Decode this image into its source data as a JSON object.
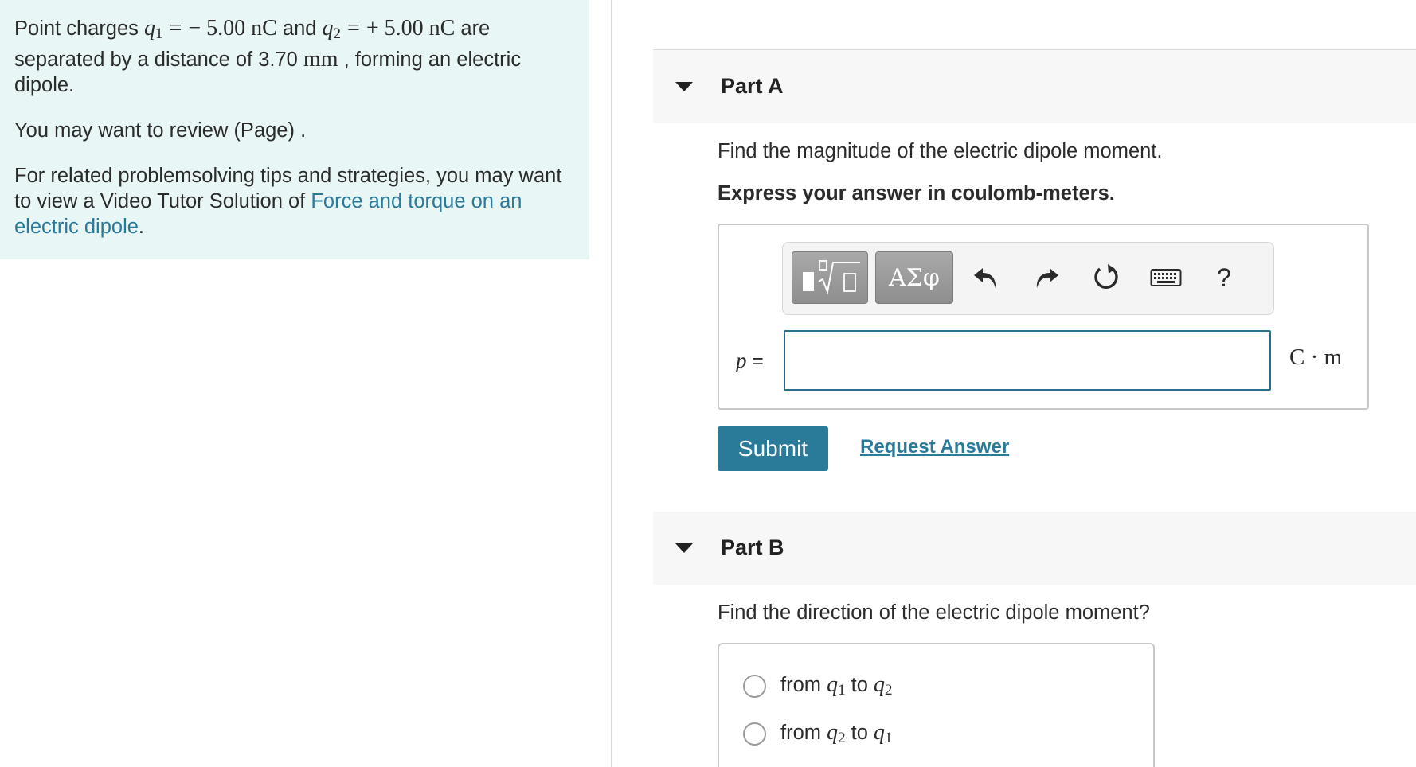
{
  "problem": {
    "p1_prefix": "Point charges ",
    "q1_symbol": "q",
    "q1_sub": "1",
    "eq1": "=",
    "q1_value": "− 5.00",
    "q1_unit": "nC",
    "and_text": " and ",
    "q2_symbol": "q",
    "q2_sub": "2",
    "eq2": "=",
    "q2_value": "+ 5.00",
    "q2_unit": "nC",
    "p1_mid": " are separated by a distance of 3.70 ",
    "dist_unit": "mm",
    "p1_suffix": " , forming an electric dipole.",
    "p2": "You may want to review (Page) .",
    "p3_text": "For related problemsolving tips and strategies, you may want to view a Video Tutor Solution of ",
    "p3_link": "Force and torque on an electric dipole",
    "p3_end": "."
  },
  "part_a": {
    "title": "Part A",
    "prompt": "Find the magnitude of the electric dipole moment.",
    "instruction": "Express your answer in coulomb-meters.",
    "toolbar": {
      "greek_label": "ΑΣφ",
      "help_label": "?"
    },
    "var_symbol": "p",
    "var_eq": "=",
    "input_value": "",
    "unit": "C · m",
    "submit_label": "Submit",
    "request_label": "Request Answer"
  },
  "part_b": {
    "title": "Part B",
    "prompt": "Find the direction of the electric dipole moment?",
    "choices": [
      {
        "from": "from ",
        "a_sym": "q",
        "a_sub": "1",
        "to": " to ",
        "b_sym": "q",
        "b_sub": "2"
      },
      {
        "from": "from ",
        "a_sym": "q",
        "a_sub": "2",
        "to": " to ",
        "b_sym": "q",
        "b_sub": "1"
      }
    ]
  },
  "icons": {
    "collapse": "caret-down-icon",
    "template": "fraction-sqrt-template-icon",
    "undo": "undo-icon",
    "redo": "redo-icon",
    "reset": "reset-icon",
    "keyboard": "keyboard-icon"
  }
}
